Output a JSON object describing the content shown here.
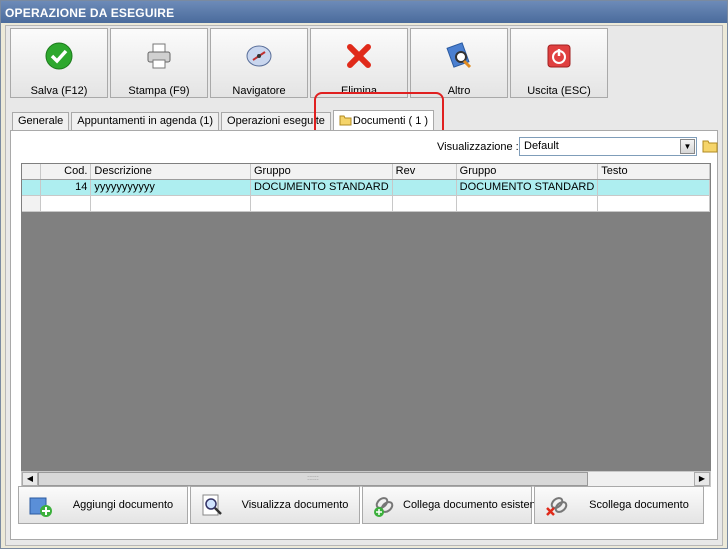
{
  "window": {
    "title": "OPERAZIONE DA ESEGUIRE"
  },
  "toolbar": {
    "save": "Salva (F12)",
    "print": "Stampa (F9)",
    "navigator": "Navigatore",
    "delete": "Elimina",
    "other": "Altro",
    "exit": "Uscita (ESC)"
  },
  "tabs": [
    {
      "label": "Generale"
    },
    {
      "label": "Appuntamenti in agenda (1)"
    },
    {
      "label": "Operazioni eseguite"
    },
    {
      "label": "Documenti ( 1 )",
      "active": true
    }
  ],
  "view": {
    "label": "Visualizzazione :",
    "value": "Default"
  },
  "grid": {
    "columns": [
      "Cod.",
      "Descrizione",
      "Gruppo",
      "Rev",
      "Gruppo",
      "Testo"
    ],
    "rows": [
      [
        "14",
        "yyyyyyyyyyy",
        "DOCUMENTO STANDARD",
        "",
        "DOCUMENTO STANDARD",
        ""
      ]
    ]
  },
  "actions": {
    "add": "Aggiungi documento",
    "view": "Visualizza documento",
    "link": "Collega documento esistente",
    "unlink": "Scollega documento"
  },
  "colors": {
    "selected_row": "#aeeef0",
    "highlight": "#e02020",
    "titlebar": "#4a6b9c"
  }
}
